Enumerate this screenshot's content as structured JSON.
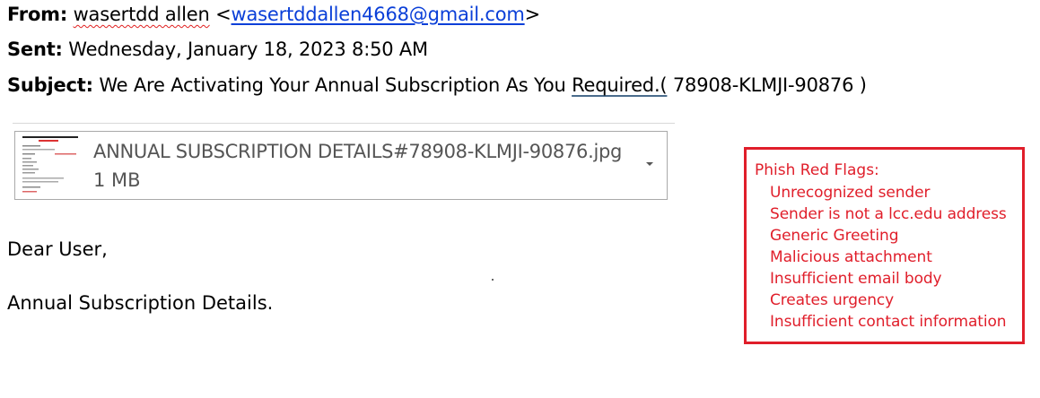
{
  "header": {
    "from_label": "From:",
    "from_name": "wasertdd allen",
    "from_open": "<",
    "from_email": "wasertddallen4668@gmail.com",
    "from_close": ">",
    "sent_label": "Sent:",
    "sent_value": "Wednesday, January 18, 2023 8:50 AM",
    "subject_label": "Subject:",
    "subject_part1": "We Are Activating Your Annual Subscription As You ",
    "subject_part2": "Required.(",
    "subject_part3": " 78908-KLMJI-90876 )"
  },
  "attachment": {
    "filename": "ANNUAL SUBSCRIPTION DETAILS#78908-KLMJI-90876.jpg",
    "size": "1 MB",
    "chevron_icon": "chevron-down-icon"
  },
  "body": {
    "greeting": "Dear User,",
    "line1": "Annual Subscription Details."
  },
  "red_flags": {
    "title": "Phish Red Flags:",
    "color": "#e01e2a",
    "items": [
      "Unrecognized sender",
      "Sender is not a lcc.edu address",
      "Generic Greeting",
      "Malicious attachment",
      "Insufficient email body",
      "Creates urgency",
      "Insufficient contact information"
    ]
  },
  "colors": {
    "link": "#0a3fd8",
    "attachment_text": "#555555",
    "attachment_border": "#a9a9a9"
  }
}
